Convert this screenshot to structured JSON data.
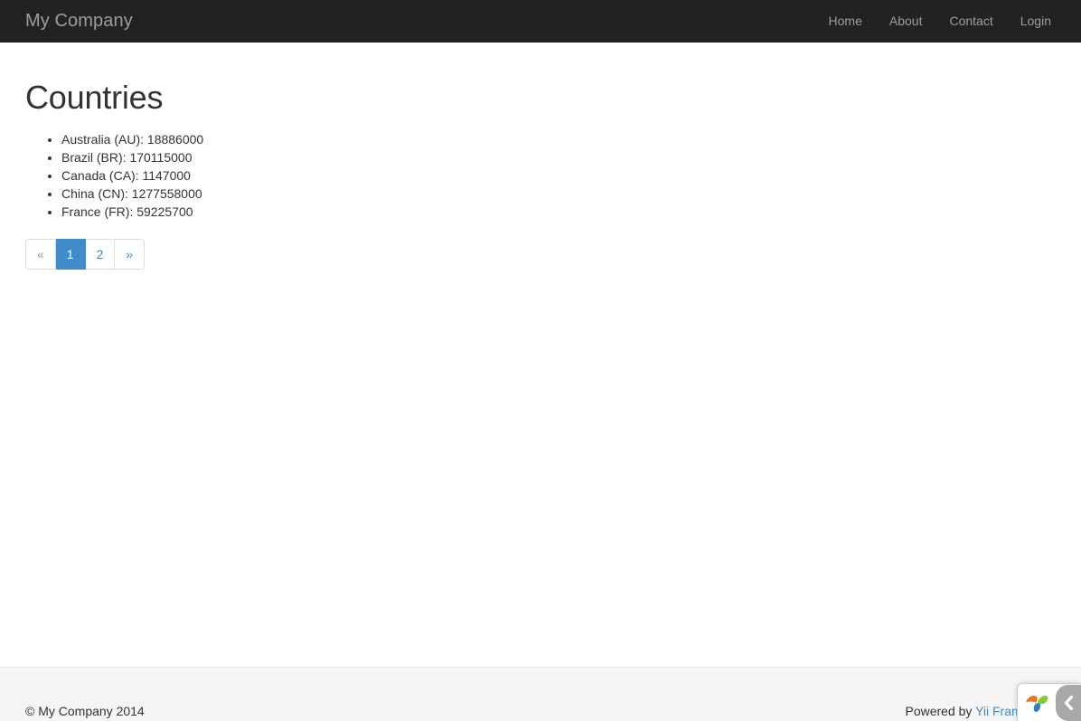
{
  "navbar": {
    "brand": "My Company",
    "items": [
      {
        "label": "Home"
      },
      {
        "label": "About"
      },
      {
        "label": "Contact"
      },
      {
        "label": "Login"
      }
    ]
  },
  "main": {
    "title": "Countries",
    "countries": [
      {
        "text": "Australia (AU): 18886000"
      },
      {
        "text": "Brazil (BR): 170115000"
      },
      {
        "text": "Canada (CA): 1147000"
      },
      {
        "text": "China (CN): 1277558000"
      },
      {
        "text": "France (FR): 59225700"
      }
    ],
    "pagination": [
      {
        "label": "«",
        "state": "disabled"
      },
      {
        "label": "1",
        "state": "active"
      },
      {
        "label": "2",
        "state": "link"
      },
      {
        "label": "»",
        "state": "link"
      }
    ]
  },
  "footer": {
    "copyright": "© My Company 2014",
    "powered_prefix": "Powered by ",
    "powered_link": "Yii Framework"
  },
  "debug_toolbar": {
    "logo_icon": "yii-logo-icon",
    "toggle_icon": "chevron-left-icon"
  },
  "colors": {
    "navbar_bg": "#222222",
    "navbar_text": "#9d9d9d",
    "link": "#428bca",
    "body_text": "#333333",
    "footer_bg": "#f5f5f5",
    "pagination_active_bg": "#428bca",
    "pagination_border": "#dddddd",
    "debug_toggle_bg": "#a8a8a8"
  }
}
